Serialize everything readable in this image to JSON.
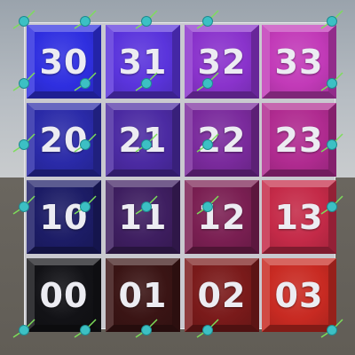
{
  "tiles": [
    {
      "label": "30",
      "color": "#2f2fe0"
    },
    {
      "label": "31",
      "color": "#5a34dc"
    },
    {
      "label": "32",
      "color": "#8a33cc"
    },
    {
      "label": "33",
      "color": "#c23ab8"
    },
    {
      "label": "20",
      "color": "#2a2aa8"
    },
    {
      "label": "21",
      "color": "#4b2aa2"
    },
    {
      "label": "22",
      "color": "#7a2a9c"
    },
    {
      "label": "23",
      "color": "#b02b90"
    },
    {
      "label": "10",
      "color": "#1c1c66"
    },
    {
      "label": "11",
      "color": "#3e1e60"
    },
    {
      "label": "12",
      "color": "#7a1f52"
    },
    {
      "label": "13",
      "color": "#c42a48"
    },
    {
      "label": "00",
      "color": "#121216"
    },
    {
      "label": "01",
      "color": "#3a1414"
    },
    {
      "label": "02",
      "color": "#7a1a1a"
    },
    {
      "label": "03",
      "color": "#c82a22"
    }
  ],
  "colors": {
    "board_frame": "#c9c9cf",
    "handle_sphere": "#3cc0c4",
    "handle_line": "#7dde5a"
  },
  "handles": {
    "type": "vertex-gizmo",
    "grid": "5x5"
  }
}
